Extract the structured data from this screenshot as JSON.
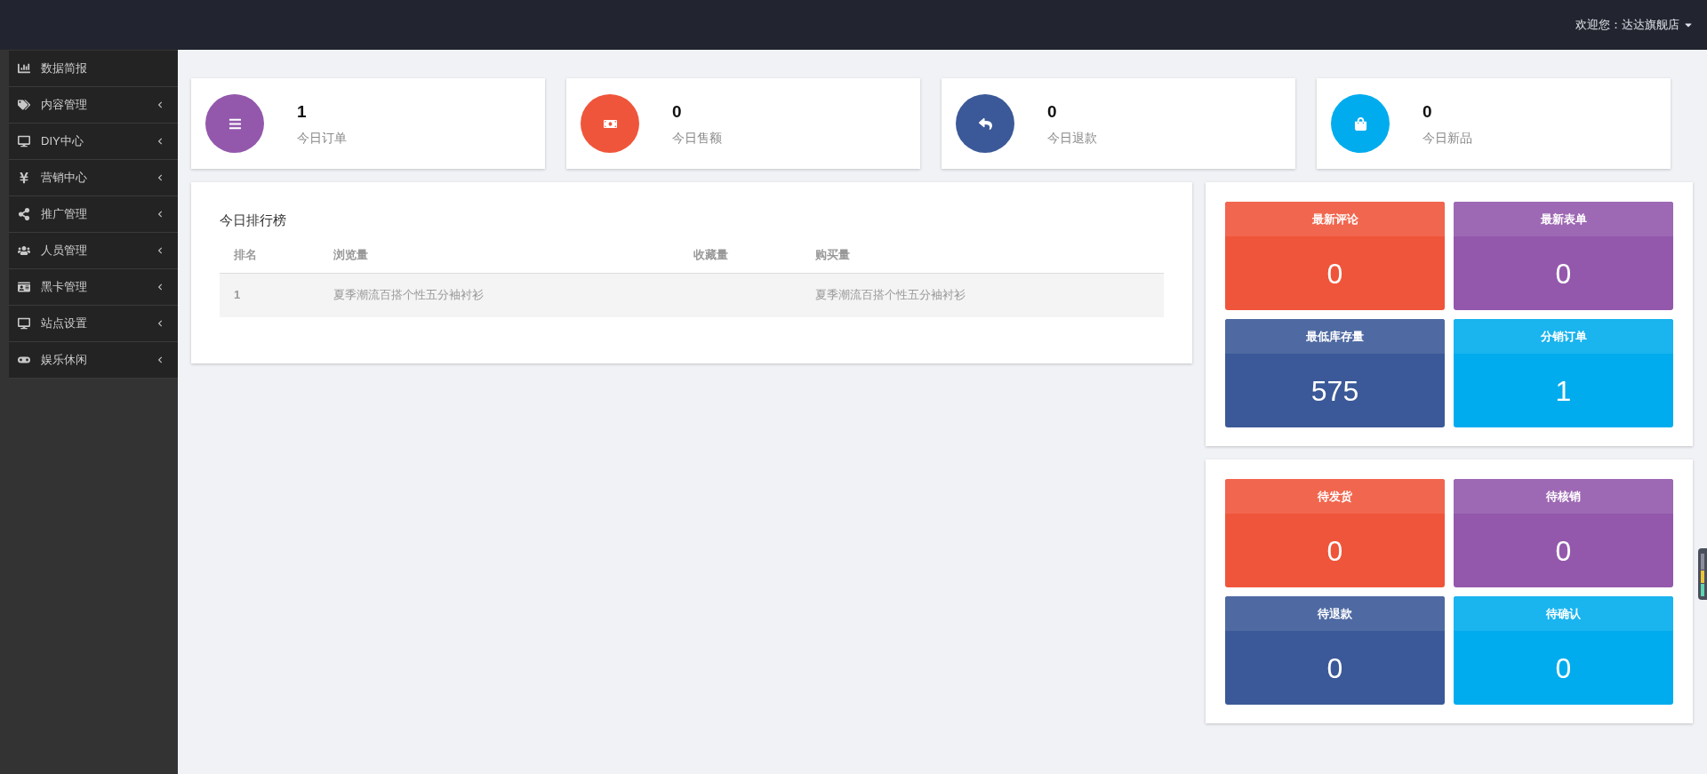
{
  "header": {
    "welcome": "欢迎您：达达旗舰店"
  },
  "sidebar": {
    "items": [
      {
        "label": "数据简报",
        "has_submenu": false
      },
      {
        "label": "内容管理",
        "has_submenu": true
      },
      {
        "label": "DIY中心",
        "has_submenu": true
      },
      {
        "label": "营销中心",
        "has_submenu": true
      },
      {
        "label": "推广管理",
        "has_submenu": true
      },
      {
        "label": "人员管理",
        "has_submenu": true
      },
      {
        "label": "黑卡管理",
        "has_submenu": true
      },
      {
        "label": "站点设置",
        "has_submenu": true
      },
      {
        "label": "娱乐休闲",
        "has_submenu": true
      }
    ]
  },
  "stats": [
    {
      "value": "1",
      "label": "今日订单",
      "color": "#9358ac"
    },
    {
      "value": "0",
      "label": "今日售额",
      "color": "#ef553a"
    },
    {
      "value": "0",
      "label": "今日退款",
      "color": "#3b5998"
    },
    {
      "value": "0",
      "label": "今日新品",
      "color": "#00aced"
    }
  ],
  "ranking": {
    "title": "今日排行榜",
    "columns": [
      "排名",
      "浏览量",
      "收藏量",
      "购买量"
    ],
    "rows": [
      [
        "1",
        "夏季潮流百搭个性五分袖衬衫",
        null,
        "夏季潮流百搭个性五分袖衬衫"
      ]
    ]
  },
  "tile_panels": [
    {
      "tiles": [
        {
          "title": "最新评论",
          "value": "0",
          "color": "#ef553a"
        },
        {
          "title": "最新表单",
          "value": "0",
          "color": "#9358ac"
        },
        {
          "title": "最低库存量",
          "value": "575",
          "color": "#3b5998"
        },
        {
          "title": "分销订单",
          "value": "1",
          "color": "#00aced"
        }
      ]
    },
    {
      "tiles": [
        {
          "title": "待发货",
          "value": "0",
          "color": "#ef553a"
        },
        {
          "title": "待核销",
          "value": "0",
          "color": "#9358ac"
        },
        {
          "title": "待退款",
          "value": "0",
          "color": "#3b5998"
        },
        {
          "title": "待确认",
          "value": "0",
          "color": "#00aced"
        }
      ]
    }
  ]
}
